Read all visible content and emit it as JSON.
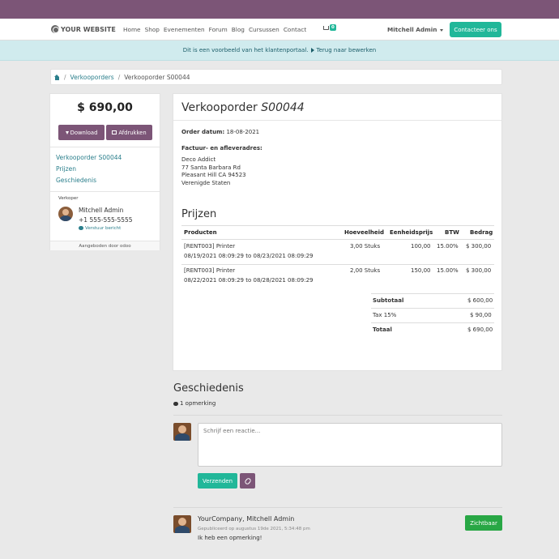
{
  "nav": {
    "brand": "YOUR WEBSITE",
    "menu": [
      "Home",
      "Shop",
      "Evenementen",
      "Forum",
      "Blog",
      "Cursussen",
      "Contact"
    ],
    "cart_count": "0",
    "user": "Mitchell Admin",
    "contact_button": "Contacteer ons"
  },
  "banner": {
    "text": "Dit is een voorbeeld van het klantenportaal.",
    "link": "Terug naar bewerken"
  },
  "breadcrumb": {
    "item1": "Verkooporders",
    "item2": "Verkooporder S00044"
  },
  "sidebar": {
    "amount": "$ 690,00",
    "download": "Download",
    "print": "Afdrukken",
    "links": [
      "Verkooporder S00044",
      "Prijzen",
      "Geschiedenis"
    ],
    "seller_label": "Verkoper",
    "seller_name": "Mitchell Admin",
    "seller_phone": "+1 555-555-5555",
    "send_message": "Verstuur bericht",
    "powered_by": "Aangeboden door odoo"
  },
  "order": {
    "title_prefix": "Verkooporder",
    "title_number": "S00044",
    "date_label": "Order datum:",
    "date_value": "18-08-2021",
    "address_label": "Factuur- en afleveradres:",
    "address_lines": [
      "Deco Addict",
      "77 Santa Barbara Rd",
      "Pleasant Hill CA 94523",
      "Verenigde Staten"
    ],
    "prices_title": "Prijzen",
    "columns": [
      "Producten",
      "Hoeveelheid",
      "Eenheidsprijs",
      "BTW",
      "Bedrag"
    ],
    "lines": [
      {
        "product": "[RENT003] Printer",
        "period": "08/19/2021 08:09:29 to 08/23/2021 08:09:29",
        "qty": "3,00 Stuks",
        "unit_price": "100,00",
        "tax": "15.00%",
        "amount": "$ 300,00"
      },
      {
        "product": "[RENT003] Printer",
        "period": "08/22/2021 08:09:29 to 08/28/2021 08:09:29",
        "qty": "2,00 Stuks",
        "unit_price": "150,00",
        "tax": "15.00%",
        "amount": "$ 300,00"
      }
    ],
    "subtotal_label": "Subtotaal",
    "subtotal_value": "$ 600,00",
    "tax_label": "Tax 15%",
    "tax_value": "$ 90,00",
    "total_label": "Totaal",
    "total_value": "$ 690,00"
  },
  "history": {
    "title": "Geschiedenis",
    "count": "1 opmerking",
    "placeholder": "Schrijf een reactie...",
    "send": "Verzenden",
    "message_author": "YourCompany, Mitchell Admin",
    "message_date": "Gepubliceerd op augustus 19de 2021, 5:34:48 pm",
    "message_body": "Ik heb een opmerking!",
    "visible_button": "Zichtbaar"
  },
  "colors": {
    "topbar": "#7c5577",
    "accent": "#21b799",
    "link": "#2b7f8c",
    "banner": "#d0ebee"
  }
}
